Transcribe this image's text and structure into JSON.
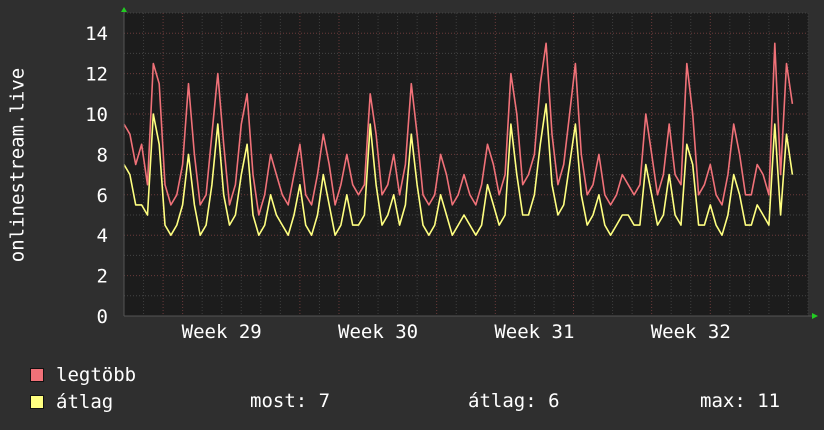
{
  "chart_data": {
    "type": "line",
    "ylabel": "onlinestream.live",
    "ylim": [
      0,
      15
    ],
    "yticks": [
      0,
      2,
      4,
      6,
      8,
      10,
      12,
      14
    ],
    "xtick_labels": [
      "Week 29",
      "Week 30",
      "Week 31",
      "Week 32"
    ],
    "x_unit": "days",
    "x_range_days": [
      0,
      35
    ],
    "xtick_days": [
      5,
      13,
      21,
      29
    ],
    "grid": true,
    "series": [
      {
        "name": "legtöbb",
        "color": "#f07178",
        "x_days": [
          0,
          0.3,
          0.6,
          0.9,
          1.2,
          1.5,
          1.8,
          2.1,
          2.4,
          2.7,
          3.0,
          3.3,
          3.6,
          3.9,
          4.2,
          4.5,
          4.8,
          5.1,
          5.4,
          5.7,
          6.0,
          6.3,
          6.6,
          6.9,
          7.2,
          7.5,
          7.8,
          8.1,
          8.4,
          8.7,
          9.0,
          9.3,
          9.6,
          9.9,
          10.2,
          10.5,
          10.8,
          11.1,
          11.4,
          11.7,
          12.0,
          12.3,
          12.6,
          12.9,
          13.2,
          13.5,
          13.8,
          14.1,
          14.4,
          14.7,
          15.0,
          15.3,
          15.6,
          15.9,
          16.2,
          16.5,
          16.8,
          17.1,
          17.4,
          17.7,
          18.0,
          18.3,
          18.6,
          18.9,
          19.2,
          19.5,
          19.8,
          20.1,
          20.4,
          20.7,
          21.0,
          21.3,
          21.6,
          21.9,
          22.2,
          22.5,
          22.8,
          23.1,
          23.4,
          23.7,
          24.0,
          24.3,
          24.6,
          24.9,
          25.2,
          25.5,
          25.8,
          26.1,
          26.4,
          26.7,
          27.0,
          27.3,
          27.6,
          27.9,
          28.2,
          28.5,
          28.8,
          29.1,
          29.4,
          29.7,
          30.0,
          30.3,
          30.6,
          30.9,
          31.2,
          31.5,
          31.8,
          32.1,
          32.4,
          32.7,
          33.0,
          33.3,
          33.6,
          33.9,
          34.2,
          34.5,
          34.8
        ],
        "values": [
          9.5,
          9.0,
          7.5,
          8.5,
          6.5,
          12.5,
          11.5,
          6.5,
          5.5,
          6.0,
          7.5,
          11.5,
          8.0,
          5.5,
          6.0,
          9.0,
          12.0,
          8.5,
          5.5,
          6.5,
          9.5,
          11.0,
          7.0,
          5.0,
          6.0,
          8.0,
          7.0,
          6.0,
          5.5,
          7.0,
          8.5,
          6.0,
          5.5,
          7.0,
          9.0,
          7.5,
          5.5,
          6.5,
          8.0,
          6.5,
          6.0,
          6.5,
          11.0,
          9.0,
          6.0,
          6.5,
          8.0,
          6.0,
          7.5,
          11.5,
          9.0,
          6.0,
          5.5,
          6.0,
          8.0,
          7.0,
          5.5,
          6.0,
          7.0,
          6.0,
          5.5,
          6.5,
          8.5,
          7.5,
          6.0,
          7.0,
          12.0,
          10.0,
          6.5,
          7.0,
          8.0,
          11.5,
          13.5,
          9.0,
          6.5,
          7.5,
          10.0,
          12.5,
          8.0,
          6.0,
          6.5,
          8.0,
          6.0,
          5.5,
          6.0,
          7.0,
          6.5,
          6.0,
          6.5,
          10.0,
          8.0,
          6.0,
          7.0,
          9.5,
          7.0,
          6.5,
          12.5,
          10.0,
          6.0,
          6.5,
          7.5,
          6.0,
          5.5,
          7.0,
          9.5,
          8.0,
          6.0,
          6.0,
          7.5,
          7.0,
          6.0,
          13.5,
          7.0,
          12.5,
          10.5
        ]
      },
      {
        "name": "átlag",
        "color": "#ffff80",
        "x_days": [
          0,
          0.3,
          0.6,
          0.9,
          1.2,
          1.5,
          1.8,
          2.1,
          2.4,
          2.7,
          3.0,
          3.3,
          3.6,
          3.9,
          4.2,
          4.5,
          4.8,
          5.1,
          5.4,
          5.7,
          6.0,
          6.3,
          6.6,
          6.9,
          7.2,
          7.5,
          7.8,
          8.1,
          8.4,
          8.7,
          9.0,
          9.3,
          9.6,
          9.9,
          10.2,
          10.5,
          10.8,
          11.1,
          11.4,
          11.7,
          12.0,
          12.3,
          12.6,
          12.9,
          13.2,
          13.5,
          13.8,
          14.1,
          14.4,
          14.7,
          15.0,
          15.3,
          15.6,
          15.9,
          16.2,
          16.5,
          16.8,
          17.1,
          17.4,
          17.7,
          18.0,
          18.3,
          18.6,
          18.9,
          19.2,
          19.5,
          19.8,
          20.1,
          20.4,
          20.7,
          21.0,
          21.3,
          21.6,
          21.9,
          22.2,
          22.5,
          22.8,
          23.1,
          23.4,
          23.7,
          24.0,
          24.3,
          24.6,
          24.9,
          25.2,
          25.5,
          25.8,
          26.1,
          26.4,
          26.7,
          27.0,
          27.3,
          27.6,
          27.9,
          28.2,
          28.5,
          28.8,
          29.1,
          29.4,
          29.7,
          30.0,
          30.3,
          30.6,
          30.9,
          31.2,
          31.5,
          31.8,
          32.1,
          32.4,
          32.7,
          33.0,
          33.3,
          33.6,
          33.9,
          34.2,
          34.5,
          34.8
        ],
        "values": [
          7.5,
          7.0,
          5.5,
          5.5,
          5.0,
          10.0,
          8.5,
          4.5,
          4.0,
          4.5,
          5.5,
          8.0,
          5.5,
          4.0,
          4.5,
          6.5,
          9.5,
          6.0,
          4.5,
          5.0,
          7.0,
          8.5,
          5.0,
          4.0,
          4.5,
          6.0,
          5.0,
          4.5,
          4.0,
          5.0,
          6.5,
          4.5,
          4.0,
          5.0,
          7.0,
          5.5,
          4.0,
          4.5,
          6.0,
          4.5,
          4.5,
          5.0,
          9.5,
          6.5,
          4.5,
          5.0,
          6.0,
          4.5,
          5.5,
          9.0,
          6.5,
          4.5,
          4.0,
          4.5,
          6.0,
          5.0,
          4.0,
          4.5,
          5.0,
          4.5,
          4.0,
          4.5,
          6.5,
          5.5,
          4.5,
          5.0,
          9.5,
          7.0,
          5.0,
          5.0,
          6.0,
          8.5,
          10.5,
          6.5,
          5.0,
          5.5,
          7.5,
          9.5,
          6.0,
          4.5,
          5.0,
          6.0,
          4.5,
          4.0,
          4.5,
          5.0,
          5.0,
          4.5,
          4.5,
          7.5,
          6.0,
          4.5,
          5.0,
          7.0,
          5.0,
          4.5,
          8.5,
          7.5,
          4.5,
          4.5,
          5.5,
          4.5,
          4.0,
          5.0,
          7.0,
          6.0,
          4.5,
          4.5,
          5.5,
          5.0,
          4.5,
          9.5,
          5.0,
          9.0,
          7.0
        ]
      }
    ]
  },
  "legend": {
    "max_label": "legtöbb",
    "avg_label": "átlag",
    "max_color": "#f07178",
    "avg_color": "#ffff80"
  },
  "stats": {
    "now": "most: 7",
    "avg": "átlag: 6",
    "max": "max: 11"
  }
}
